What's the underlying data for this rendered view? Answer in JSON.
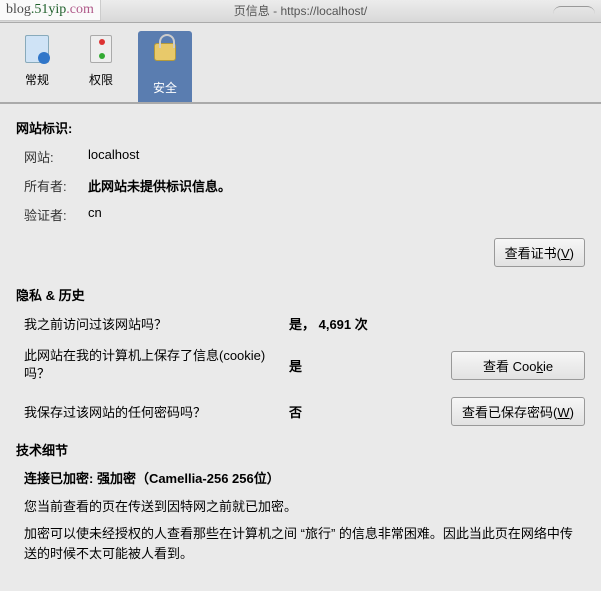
{
  "watermark": {
    "p1": "blog",
    "p2": ".51yip",
    "p3": ".com"
  },
  "titlebar": {
    "text": "页信息 - https://localhost/"
  },
  "tabs": [
    {
      "label": "常规",
      "icon": "doc"
    },
    {
      "label": "权限",
      "icon": "perm"
    },
    {
      "label": "安全",
      "icon": "lock"
    }
  ],
  "identity": {
    "title": "网站标识:",
    "rows": [
      {
        "label": "网站:",
        "value": "localhost"
      },
      {
        "label": "所有者:",
        "value": "此网站未提供标识信息。",
        "bold": true
      },
      {
        "label": "验证者:",
        "value": "cn"
      }
    ]
  },
  "buttons": {
    "view_cert": {
      "text": "查看证书(",
      "accel": "V",
      "suffix": ")"
    },
    "view_cookie": {
      "text": "查看 Coo",
      "accel": "k",
      "suffix": "ie"
    },
    "view_pw": {
      "text": "查看已保存密码(",
      "accel": "W",
      "suffix": ")"
    }
  },
  "privacy": {
    "title": "隐私 & 历史",
    "rows": [
      {
        "q": "我之前访问过该网站吗？",
        "a": "是， 4,691 次"
      },
      {
        "q": "此网站在我的计算机上保存了信息(cookie)吗？",
        "a": "是",
        "btn": "view_cookie"
      },
      {
        "q": "我保存过该网站的任何密码吗？",
        "a": "否",
        "btn": "view_pw"
      }
    ]
  },
  "tech": {
    "title": "技术细节",
    "enc_line": "连接已加密: 强加密（Camellia-256 256位）",
    "p1": "您当前查看的页在传送到因特网之前就已加密。",
    "p2": "加密可以使未经授权的人查看那些在计算机之间 “旅行” 的信息非常困难。因此当此页在网络中传送的时候不太可能被人看到。"
  }
}
